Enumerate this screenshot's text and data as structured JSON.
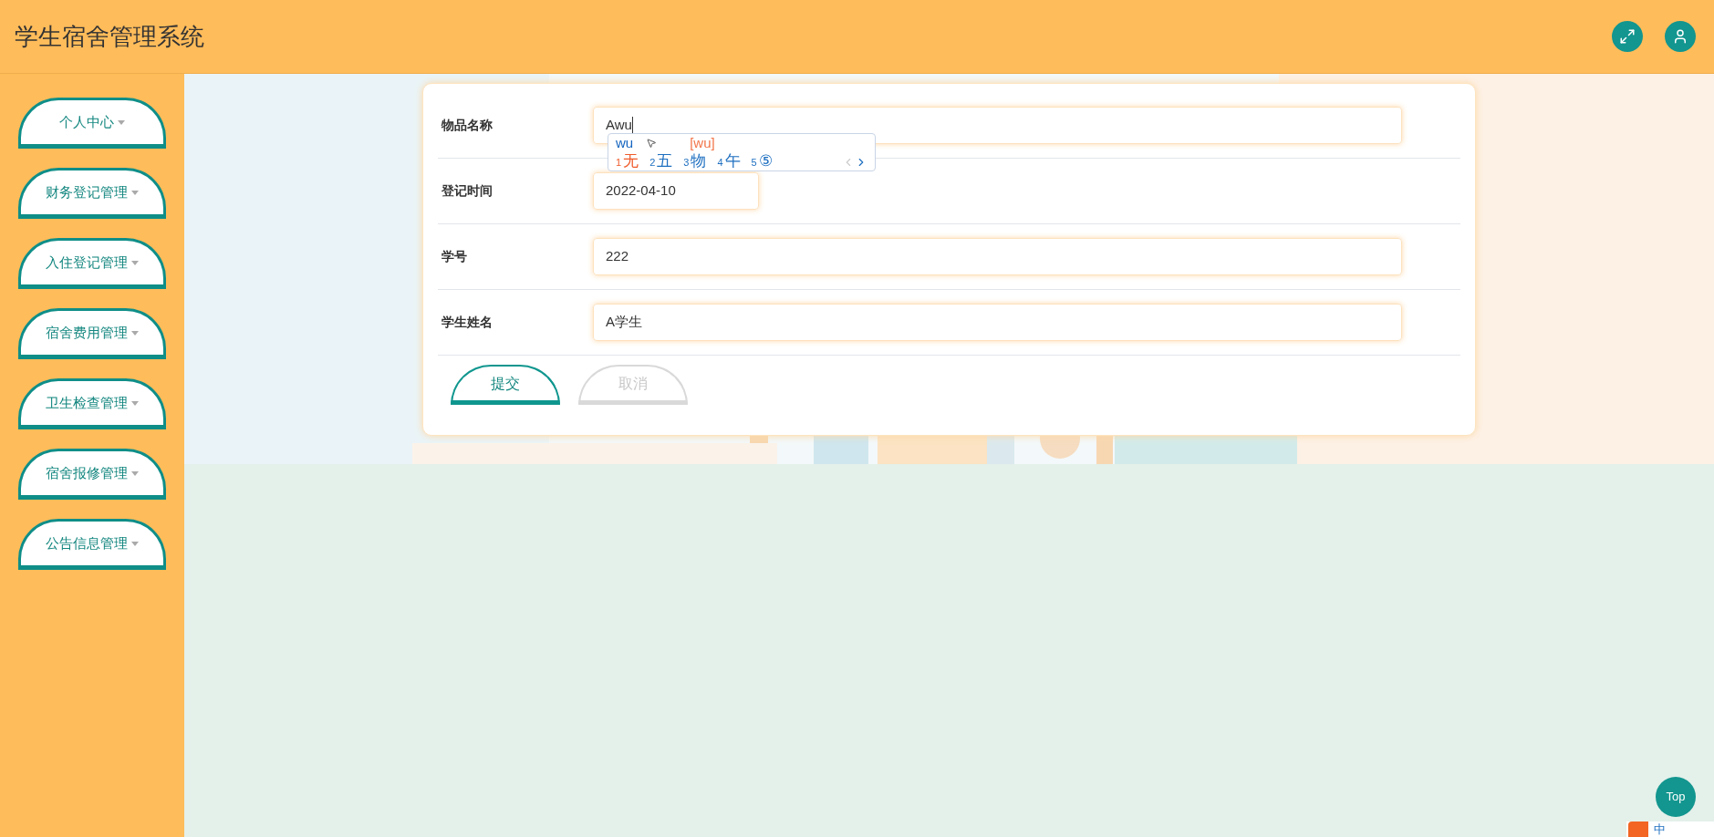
{
  "header": {
    "title": "学生宿舍管理系统"
  },
  "sidebar": {
    "items": [
      {
        "label": "个人中心"
      },
      {
        "label": "财务登记管理"
      },
      {
        "label": "入住登记管理"
      },
      {
        "label": "宿舍费用管理"
      },
      {
        "label": "卫生检查管理"
      },
      {
        "label": "宿舍报修管理"
      },
      {
        "label": "公告信息管理"
      }
    ]
  },
  "form": {
    "fields": [
      {
        "label": "物品名称",
        "value": "Awu",
        "kind": "text",
        "focused": true
      },
      {
        "label": "登记时间",
        "value": "2022-04-10",
        "kind": "date",
        "focused": false
      },
      {
        "label": "学号",
        "value": "222",
        "kind": "text",
        "focused": false
      },
      {
        "label": "学生姓名",
        "value": "A学生",
        "kind": "text",
        "focused": false
      }
    ],
    "buttons": [
      {
        "label": "提交",
        "kind": "submit"
      },
      {
        "label": "取消",
        "kind": "cancel"
      }
    ]
  },
  "ime": {
    "composition": "wu",
    "pinyin": "[wu]",
    "candidates": [
      {
        "index": "1",
        "text": "无",
        "selected": true
      },
      {
        "index": "2",
        "text": "五",
        "selected": false
      },
      {
        "index": "3",
        "text": "物",
        "selected": false
      },
      {
        "index": "4",
        "text": "午",
        "selected": false
      },
      {
        "index": "5",
        "text": "⑤",
        "selected": false
      }
    ],
    "prev_disabled": true,
    "next_disabled": false
  },
  "top_button": {
    "label": "Top"
  },
  "ime_status": {
    "mode": "中"
  }
}
